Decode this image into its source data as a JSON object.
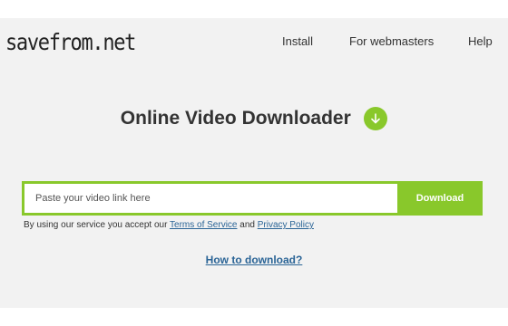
{
  "header": {
    "logo": "savefrom.net",
    "nav": {
      "install": "Install",
      "webmasters": "For webmasters",
      "help": "Help"
    }
  },
  "main": {
    "title": "Online Video Downloader",
    "title_icon": "download-arrow-icon",
    "input": {
      "placeholder": "Paste your video link here",
      "value": ""
    },
    "download_button": "Download",
    "terms": {
      "prefix": "By using our service you accept our ",
      "terms_link": "Terms of Service",
      "connector": " and ",
      "privacy_link": "Privacy Policy"
    },
    "how_to_link": "How to download?"
  },
  "colors": {
    "accent": "#89c82b",
    "background": "#f2f2f2",
    "link": "#2a6496"
  }
}
